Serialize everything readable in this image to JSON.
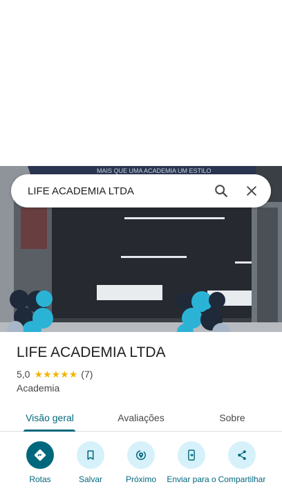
{
  "search": {
    "query": "LIFE ACADEMIA LTDA"
  },
  "photo": {
    "banner_text": "MAIS QUE UMA ACADEMIA UM ESTILO"
  },
  "place": {
    "name": "LIFE ACADEMIA LTDA",
    "rating": "5,0",
    "stars": 5,
    "review_count": "(7)",
    "category": "Academia"
  },
  "tabs": [
    {
      "label": "Visão geral",
      "active": true
    },
    {
      "label": "Avaliações",
      "active": false
    },
    {
      "label": "Sobre",
      "active": false
    }
  ],
  "actions": [
    {
      "label": "Rotas",
      "icon": "directions-icon"
    },
    {
      "label": "Salvar",
      "icon": "bookmark-icon"
    },
    {
      "label": "Próximo",
      "icon": "nearby-icon"
    },
    {
      "label": "Enviar para o",
      "icon": "send-to-phone-icon"
    },
    {
      "label": "Compartilhar",
      "icon": "share-icon"
    }
  ],
  "colors": {
    "accent": "#00677d",
    "action_bg": "#d6f1fa",
    "star": "#f4b400",
    "balloon_blue": "#2bb3d6",
    "balloon_dark": "#1e2a3a"
  }
}
